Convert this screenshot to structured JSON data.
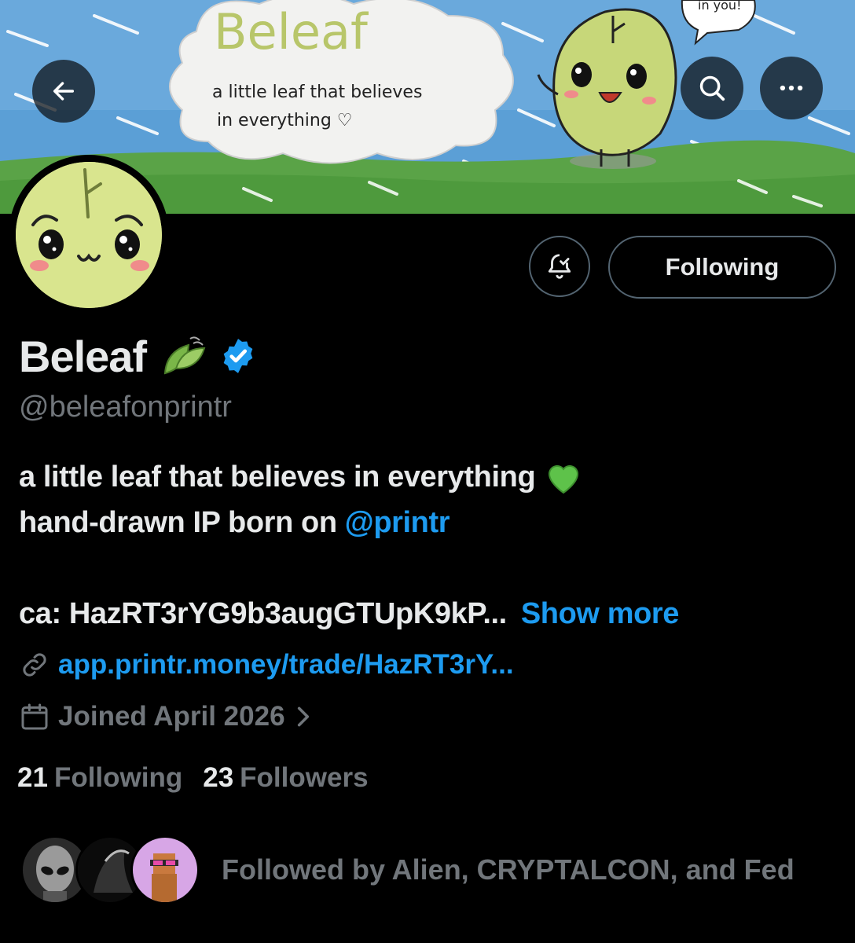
{
  "header": {
    "back_icon": "arrow-left-icon",
    "search_icon": "search-icon",
    "more_icon": "more-horizontal-icon"
  },
  "banner": {
    "title_art": "Beleaf",
    "tagline_line1": "a little leaf that believes",
    "tagline_line2": "in everything ♡",
    "speech_text": "in you!"
  },
  "actions": {
    "notification_icon": "bell-check-icon",
    "following_label": "Following"
  },
  "profile": {
    "display_name": "Beleaf",
    "name_emoji": "leaves-icon",
    "verified": true,
    "handle": "@beleafonprintr",
    "bio_line1": "a little leaf that believes in everything",
    "bio_line1_emoji": "💚",
    "bio_line2_prefix": "hand-drawn IP born on",
    "bio_mention": "@printr",
    "bio_line3": "ca: HazRT3rYG9b3augGTUpK9kP...",
    "show_more": "Show more",
    "link": "app.printr.money/trade/HazRT3rY...",
    "joined": "Joined April 2026"
  },
  "stats": {
    "following_count": "21",
    "following_label": "Following",
    "followers_count": "23",
    "followers_label": "Followers"
  },
  "followed_by": {
    "text": "Followed by Alien, CRYPTALCON, and Fed",
    "avatars": [
      "alien-avatar",
      "cryptalcon-avatar",
      "fed-avatar"
    ]
  },
  "colors": {
    "background": "#000000",
    "accent": "#1d9bf0",
    "muted": "#71767b",
    "text": "#e7e9ea",
    "leaf": "#d9e58e"
  }
}
